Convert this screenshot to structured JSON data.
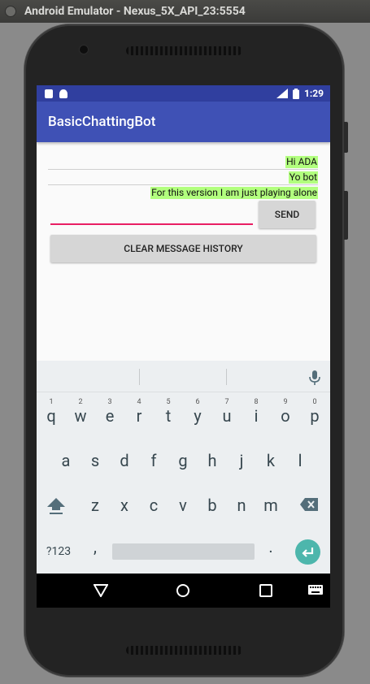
{
  "window": {
    "title": "Android Emulator - Nexus_5X_API_23:5554"
  },
  "status_bar": {
    "time": "1:29",
    "network": "LTE"
  },
  "app": {
    "title": "BasicChattingBot"
  },
  "chat": {
    "messages": [
      {
        "text": "Hi ADA"
      },
      {
        "text": "Yo bot"
      },
      {
        "text": "For this version I am just playing alone"
      }
    ],
    "input_value": "",
    "send_label": "SEND",
    "clear_label": "CLEAR MESSAGE HISTORY"
  },
  "keyboard": {
    "row1": [
      {
        "k": "q",
        "h": "1"
      },
      {
        "k": "w",
        "h": "2"
      },
      {
        "k": "e",
        "h": "3"
      },
      {
        "k": "r",
        "h": "4"
      },
      {
        "k": "t",
        "h": "5"
      },
      {
        "k": "y",
        "h": "6"
      },
      {
        "k": "u",
        "h": "7"
      },
      {
        "k": "i",
        "h": "8"
      },
      {
        "k": "o",
        "h": "9"
      },
      {
        "k": "p",
        "h": "0"
      }
    ],
    "row2": [
      "a",
      "s",
      "d",
      "f",
      "g",
      "h",
      "j",
      "k",
      "l"
    ],
    "row3": [
      "z",
      "x",
      "c",
      "v",
      "b",
      "n",
      "m"
    ],
    "symbols_label": "?123",
    "comma": ",",
    "period": "."
  },
  "colors": {
    "primary": "#3f51b5",
    "primary_dark": "#303f9f",
    "accent": "#e91e63",
    "message_highlight": "#b2ff7e",
    "enter_key": "#4db6ac"
  }
}
